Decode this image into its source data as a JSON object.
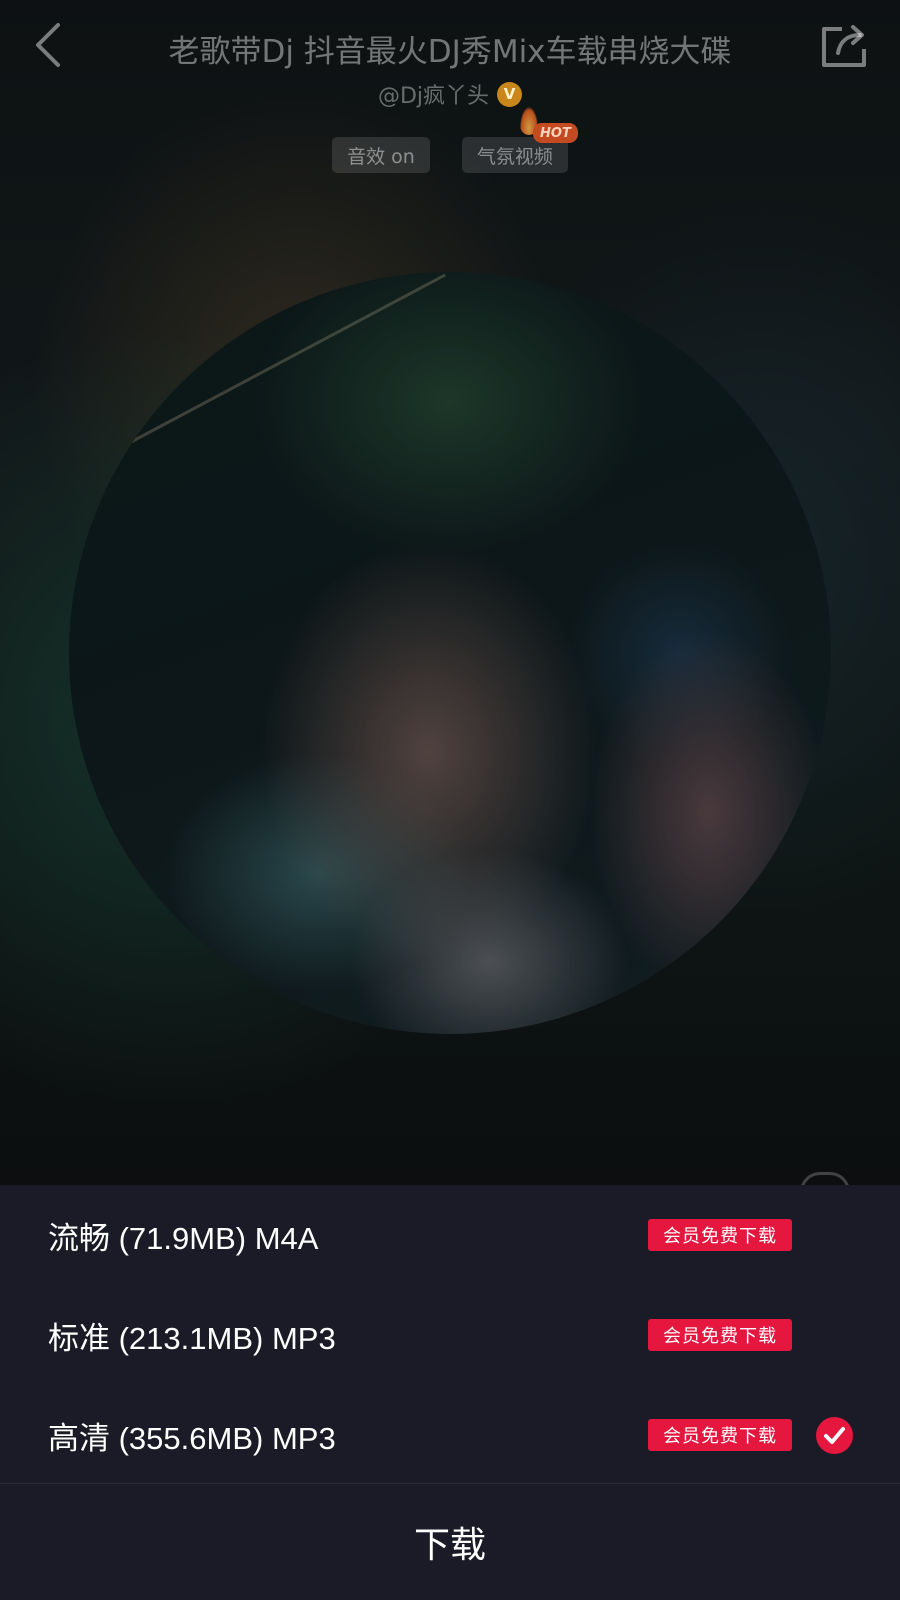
{
  "header": {
    "title": "老歌带Dj 抖音最火DJ秀Mix车载串烧大碟",
    "artist": "@Dj疯丫头",
    "verified_badge": "V"
  },
  "chips": {
    "sound_effect": "音效 on",
    "ambient_video": "气氛视频",
    "hot_badge": "HOT"
  },
  "quality_options": [
    {
      "label": "流畅 (71.9MB) M4A",
      "badge": "会员免费下载",
      "selected": false
    },
    {
      "label": "标准 (213.1MB) MP3",
      "badge": "会员免费下载",
      "selected": false
    },
    {
      "label": "高清 (355.6MB) MP3",
      "badge": "会员免费下载",
      "selected": true
    }
  ],
  "download_label": "下载",
  "colors": {
    "accent_red": "#e5173f",
    "sheet_background": "#1a1b26",
    "verified_gold": "#c9861a"
  },
  "icons": {
    "back": "chevron-left-icon",
    "share": "share-icon",
    "check": "check-circle-icon"
  }
}
